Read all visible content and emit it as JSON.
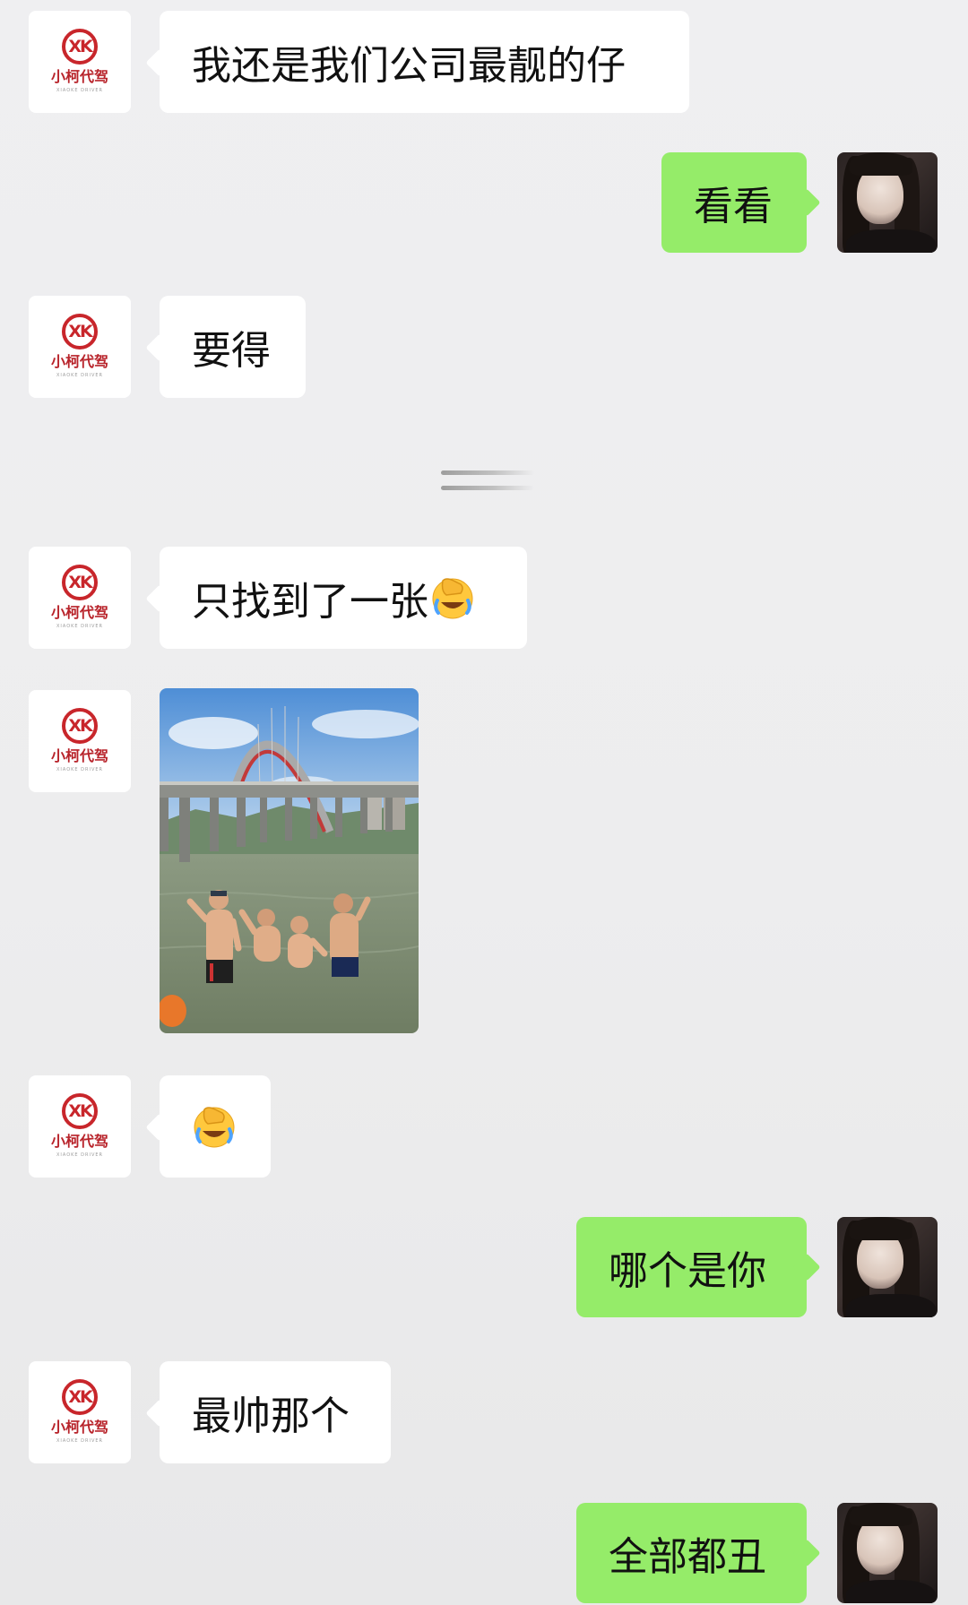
{
  "contact": {
    "logo_letters": "XK",
    "logo_name": "小柯代驾",
    "logo_sub": "XIAOKE DRIVER"
  },
  "messages": [
    {
      "side": "left",
      "text": "我还是我们公司最靓的仔"
    },
    {
      "side": "right",
      "text": "看看"
    },
    {
      "side": "left",
      "text": "要得"
    },
    {
      "side": "left",
      "text": "只找到了一张",
      "emoji": "facepalm-laughing"
    },
    {
      "side": "left",
      "type": "image",
      "image": "group-photo-river-bridge"
    },
    {
      "side": "left",
      "emoji": "facepalm-laughing"
    },
    {
      "side": "right",
      "text": "哪个是你"
    },
    {
      "side": "left",
      "text": "最帅那个"
    },
    {
      "side": "right",
      "text": "全部都丑"
    }
  ],
  "colors": {
    "background": "#ededee",
    "left_bubble": "#ffffff",
    "right_bubble": "#95ec69",
    "brand_red": "#c8262b"
  }
}
